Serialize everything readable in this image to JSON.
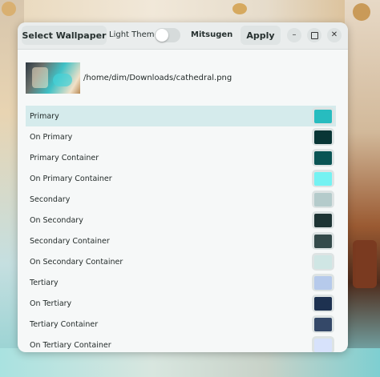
{
  "toolbar": {
    "select_wallpaper_label": "Select Wallpaper",
    "light_theme_label": "Light Theme",
    "light_theme_enabled": false,
    "scheme_label": "Mitsugen",
    "apply_label": "Apply"
  },
  "window_controls": {
    "minimize_icon": "minimize-icon",
    "maximize_icon": "maximize-icon",
    "close_icon": "close-icon"
  },
  "wallpaper": {
    "path": "/home/dim/Downloads/cathedral.png"
  },
  "colors": [
    {
      "label": "Primary",
      "color": "#27bcbf",
      "selected": true
    },
    {
      "label": "On Primary",
      "color": "#083535",
      "selected": false
    },
    {
      "label": "Primary Container",
      "color": "#0a5454",
      "selected": false
    },
    {
      "label": "On Primary Container",
      "color": "#74f2f2",
      "selected": false
    },
    {
      "label": "Secondary",
      "color": "#b4cbcb",
      "selected": false
    },
    {
      "label": "On Secondary",
      "color": "#1d3434",
      "selected": false
    },
    {
      "label": "Secondary Container",
      "color": "#344a4a",
      "selected": false
    },
    {
      "label": "On Secondary Container",
      "color": "#cfe6e4",
      "selected": false
    },
    {
      "label": "Tertiary",
      "color": "#b6caeb",
      "selected": false
    },
    {
      "label": "On Tertiary",
      "color": "#1d3150",
      "selected": false
    },
    {
      "label": "Tertiary Container",
      "color": "#344868",
      "selected": false
    },
    {
      "label": "On Tertiary Container",
      "color": "#d7e2fb",
      "selected": false
    }
  ]
}
